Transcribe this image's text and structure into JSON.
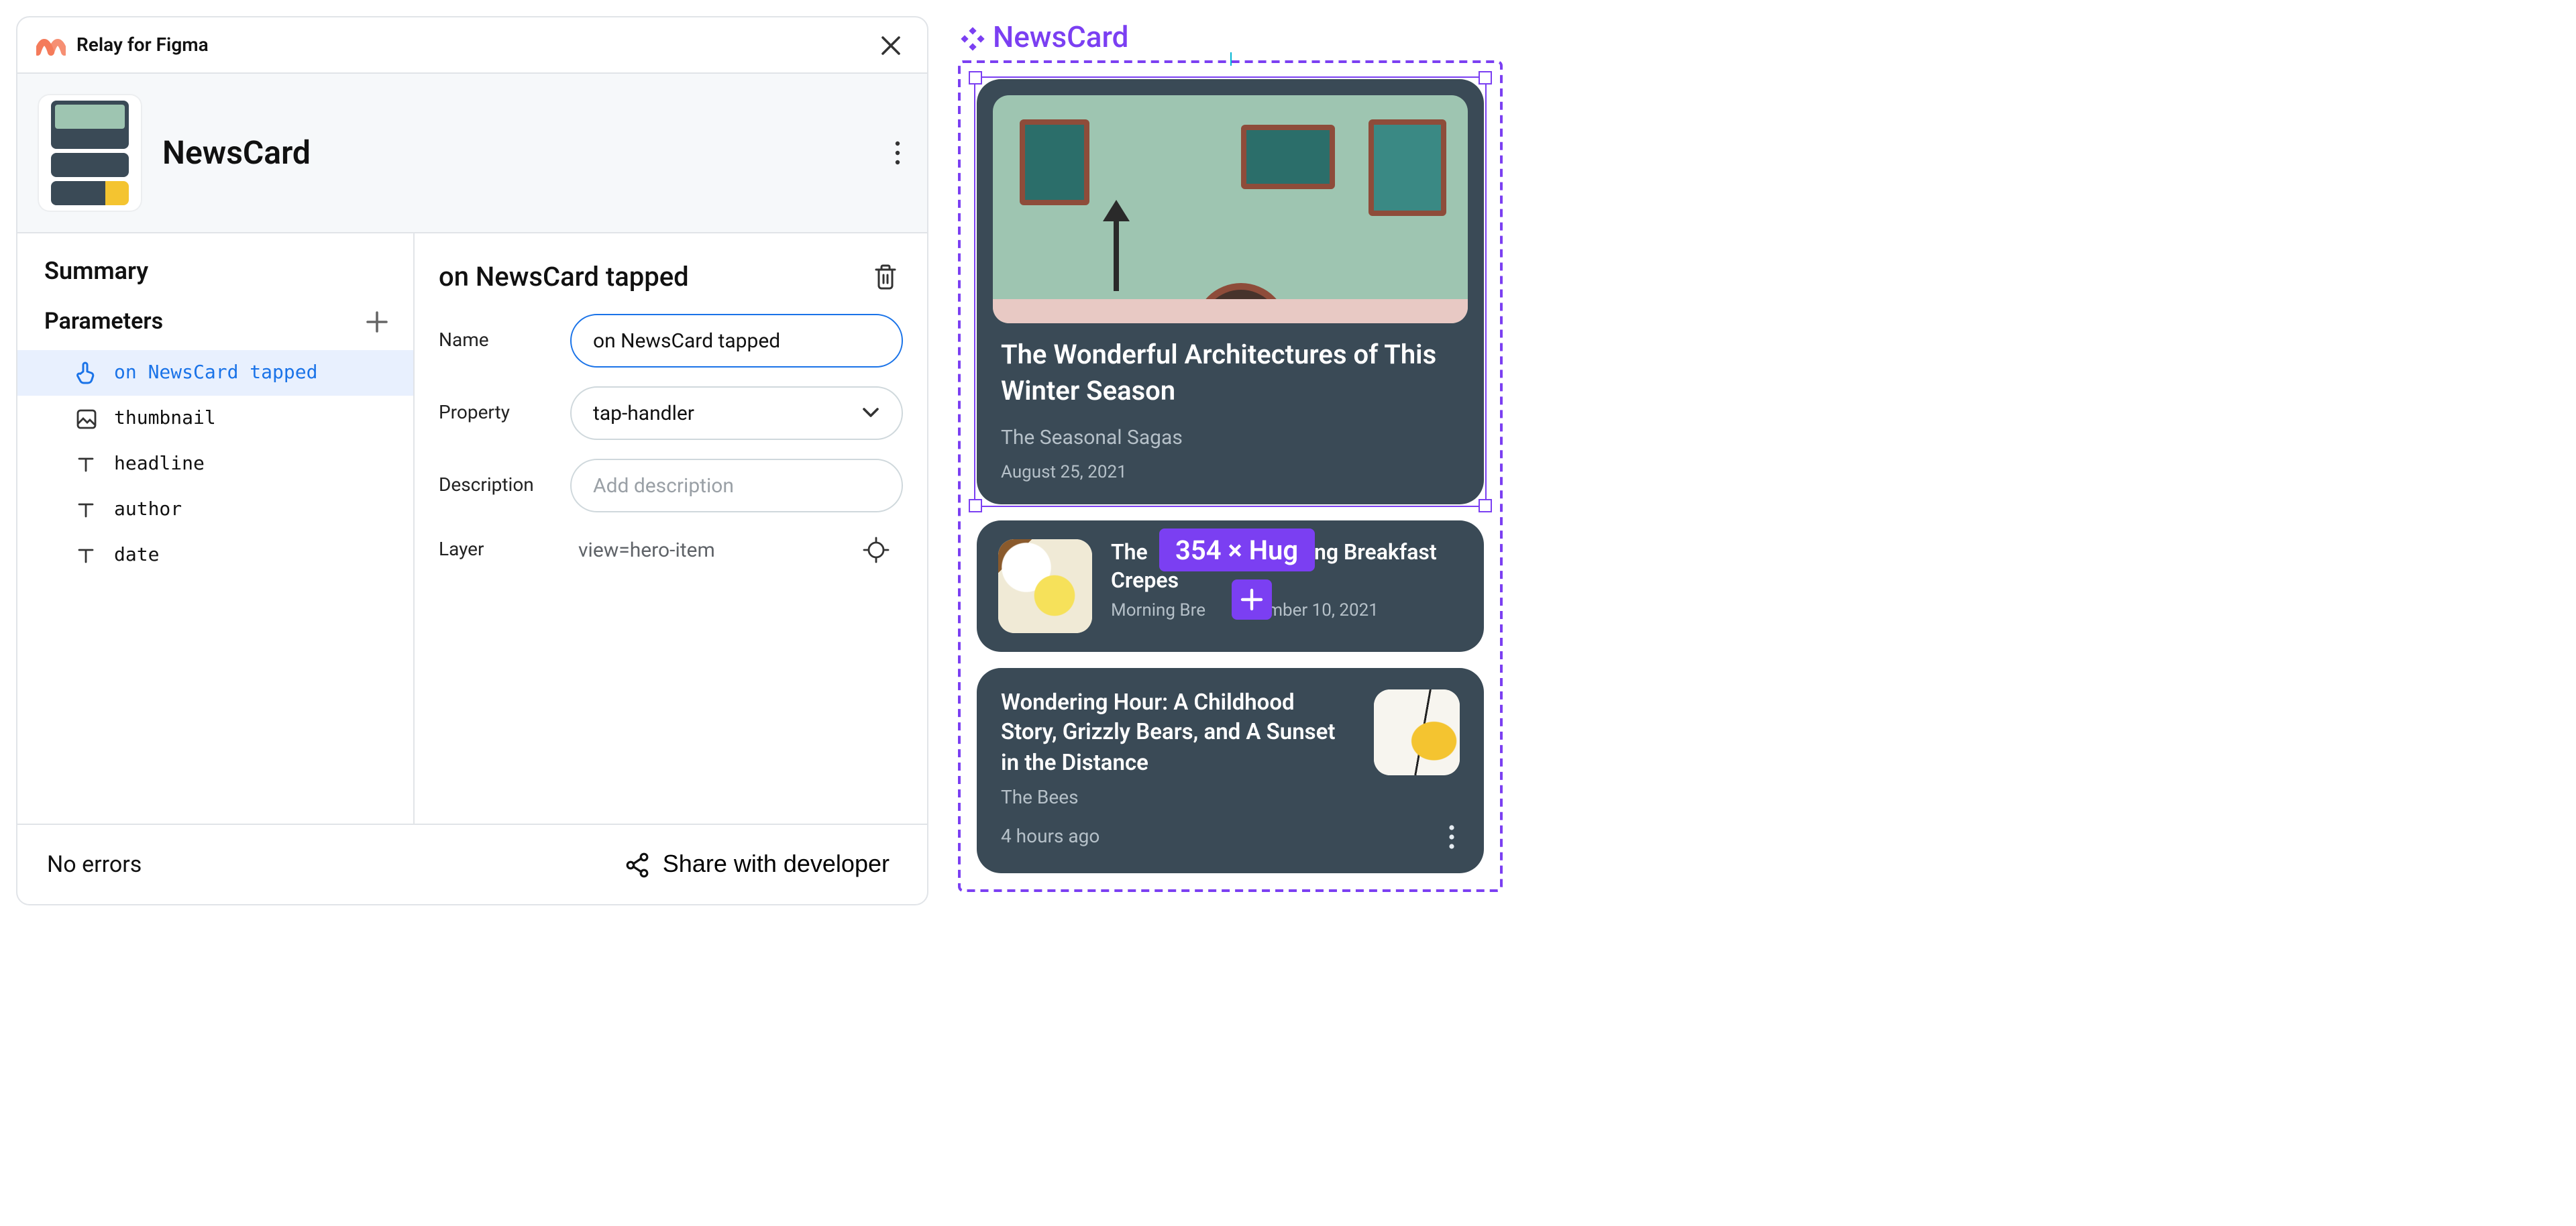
{
  "relay": {
    "product_name": "Relay for Figma",
    "component_name": "NewsCard",
    "sidebar": {
      "summary_label": "Summary",
      "parameters_label": "Parameters",
      "items": [
        {
          "label": "on NewsCard tapped",
          "icon": "tap-icon",
          "selected": true
        },
        {
          "label": "thumbnail",
          "icon": "image-icon",
          "selected": false
        },
        {
          "label": "headline",
          "icon": "text-icon",
          "selected": false
        },
        {
          "label": "author",
          "icon": "text-icon",
          "selected": false
        },
        {
          "label": "date",
          "icon": "text-icon",
          "selected": false
        }
      ]
    },
    "detail": {
      "title": "on NewsCard tapped",
      "fields": {
        "name_label": "Name",
        "name_value": "on NewsCard tapped",
        "property_label": "Property",
        "property_value": "tap-handler",
        "description_label": "Description",
        "description_placeholder": "Add description",
        "layer_label": "Layer",
        "layer_value": "view=hero-item"
      }
    },
    "footer": {
      "errors_text": "No errors",
      "share_label": "Share with developer"
    }
  },
  "canvas": {
    "frame_label": "NewsCard",
    "selection_dims": "354 × Hug",
    "cards": {
      "hero": {
        "headline": "The Wonderful Architectures of This Winter Season",
        "author": "The Seasonal Sagas",
        "date": "August 25, 2021"
      },
      "row1": {
        "headline_partial_left": "The",
        "headline_partial_right": "Making Breakfast Crepes",
        "meta_left": "Morning Bre",
        "meta_right": "ovember 10, 2021"
      },
      "audio": {
        "headline": "Wondering Hour: A Childhood Story, Grizzly Bears, and A Sunset in the Distance",
        "author": "The Bees",
        "time": "4 hours ago"
      }
    }
  }
}
